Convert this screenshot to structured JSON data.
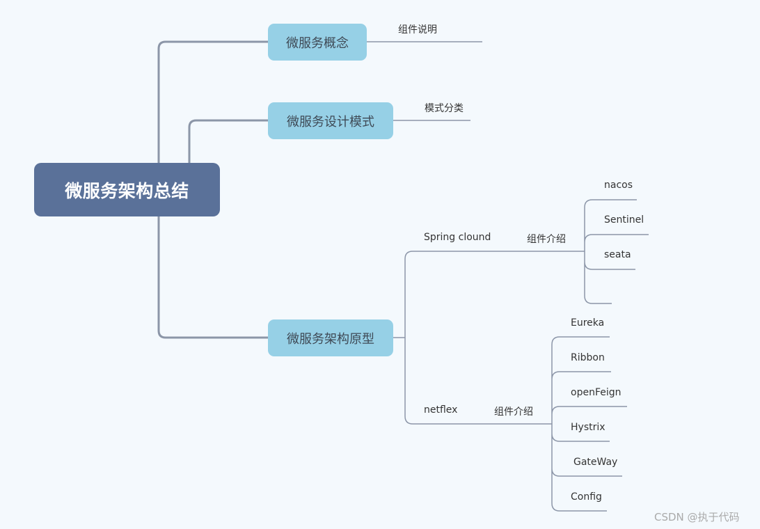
{
  "root": {
    "label": "微服务架构总结"
  },
  "topics": [
    {
      "label": "微服务概念",
      "children": [
        {
          "label": "组件说明"
        }
      ]
    },
    {
      "label": "微服务设计模式",
      "children": [
        {
          "label": "模式分类"
        }
      ]
    },
    {
      "label": "微服务架构原型",
      "children": [
        {
          "label": "Spring clound",
          "sub": {
            "label": "组件介绍",
            "items": [
              "nacos",
              "Sentinel",
              "seata",
              ""
            ]
          }
        },
        {
          "label": "netflex",
          "sub": {
            "label": "组件介绍",
            "items": [
              "Eureka",
              "Ribbon",
              "openFeign",
              "Hystrix",
              "GateWay",
              "Config"
            ]
          }
        }
      ]
    }
  ],
  "colors": {
    "root": "#5a7199",
    "topic": "#96d0e6",
    "line": "#8c96a8",
    "background": "#f4f9fd"
  },
  "watermark": "CSDN @执于代码"
}
